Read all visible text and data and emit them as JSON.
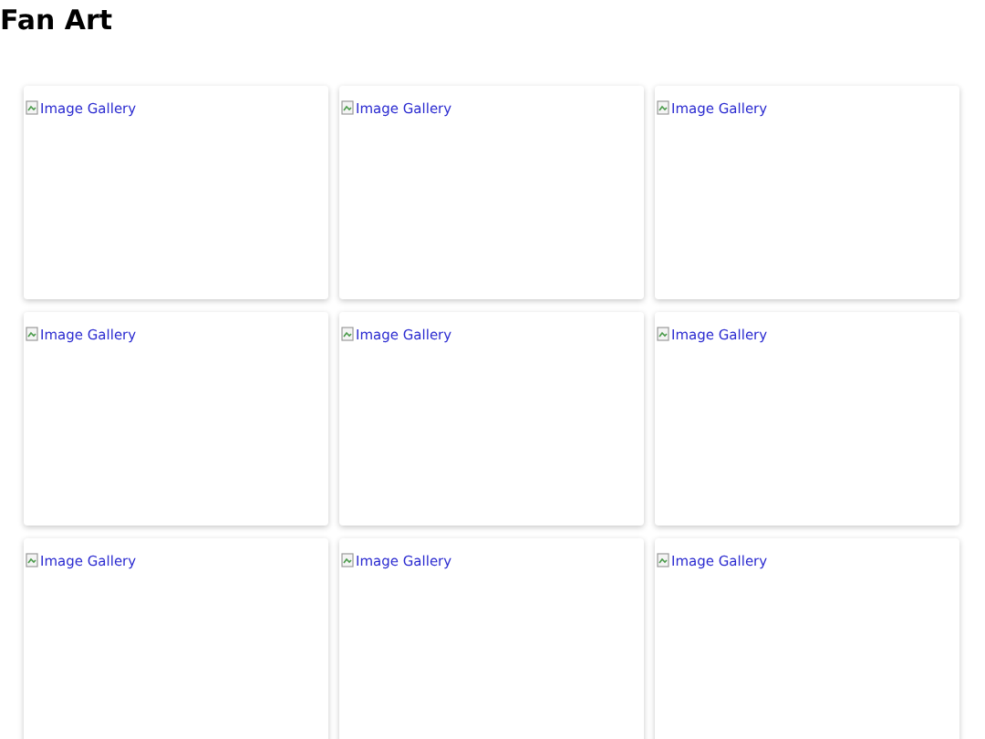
{
  "title": "Fan Art",
  "gallery": [
    {
      "alt": "Image Gallery"
    },
    {
      "alt": "Image Gallery"
    },
    {
      "alt": "Image Gallery"
    },
    {
      "alt": "Image Gallery"
    },
    {
      "alt": "Image Gallery"
    },
    {
      "alt": "Image Gallery"
    },
    {
      "alt": "Image Gallery"
    },
    {
      "alt": "Image Gallery"
    },
    {
      "alt": "Image Gallery"
    }
  ]
}
